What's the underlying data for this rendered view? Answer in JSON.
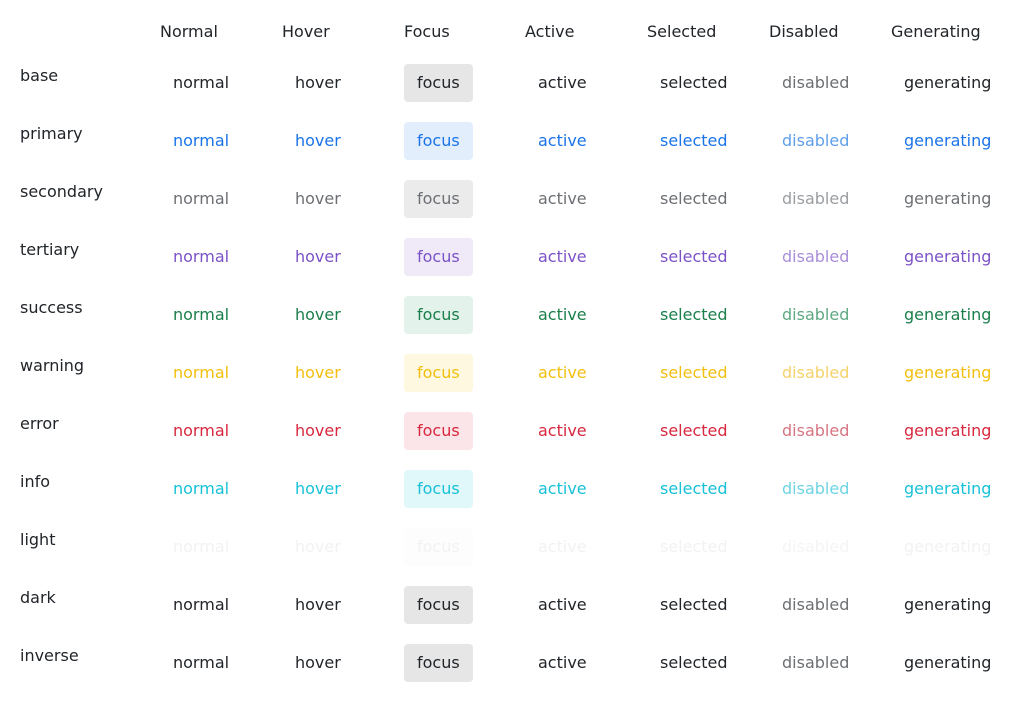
{
  "columns": [
    {
      "key": "normal",
      "label": "Normal"
    },
    {
      "key": "hover",
      "label": "Hover"
    },
    {
      "key": "focus",
      "label": "Focus"
    },
    {
      "key": "active",
      "label": "Active"
    },
    {
      "key": "selected",
      "label": "Selected"
    },
    {
      "key": "disabled",
      "label": "Disabled"
    },
    {
      "key": "generating",
      "label": "Generating"
    }
  ],
  "cell_text": {
    "normal": "normal",
    "hover": "hover",
    "focus": "focus",
    "active": "active",
    "selected": "selected",
    "disabled": "disabled",
    "generating": "generating"
  },
  "rows": [
    {
      "key": "base",
      "label": "base",
      "color": "#212529",
      "disabled_color": "#6c6f73",
      "focus_bg": "#e6e6e6"
    },
    {
      "key": "primary",
      "label": "primary",
      "color": "#1a73e8",
      "disabled_color": "#5f9eea",
      "focus_bg": "#e3eefd"
    },
    {
      "key": "secondary",
      "label": "secondary",
      "color": "#6c6f73",
      "disabled_color": "#9a9da1",
      "focus_bg": "#ebebec"
    },
    {
      "key": "tertiary",
      "label": "tertiary",
      "color": "#7b52c7",
      "disabled_color": "#a98fd9",
      "focus_bg": "#efe9f8"
    },
    {
      "key": "success",
      "label": "success",
      "color": "#1a7f4b",
      "disabled_color": "#5fa882",
      "focus_bg": "#e3f2ea"
    },
    {
      "key": "warning",
      "label": "warning",
      "color": "#f2bf0f",
      "disabled_color": "#f5d36a",
      "focus_bg": "#fef8e0"
    },
    {
      "key": "error",
      "label": "error",
      "color": "#d8273e",
      "disabled_color": "#d67582",
      "focus_bg": "#fbe5e8"
    },
    {
      "key": "info",
      "label": "info",
      "color": "#17c1d8",
      "disabled_color": "#6ed4e3",
      "focus_bg": "#e1f8fb"
    },
    {
      "key": "light",
      "label": "light",
      "color": "#f2f2f2",
      "disabled_color": "#f5f5f5",
      "focus_bg": "#fdfdfd"
    },
    {
      "key": "dark",
      "label": "dark",
      "color": "#212529",
      "disabled_color": "#6c6f73",
      "focus_bg": "#e6e6e6"
    },
    {
      "key": "inverse",
      "label": "inverse",
      "color": "#212529",
      "disabled_color": "#6c6f73",
      "focus_bg": "#e6e6e6"
    }
  ]
}
